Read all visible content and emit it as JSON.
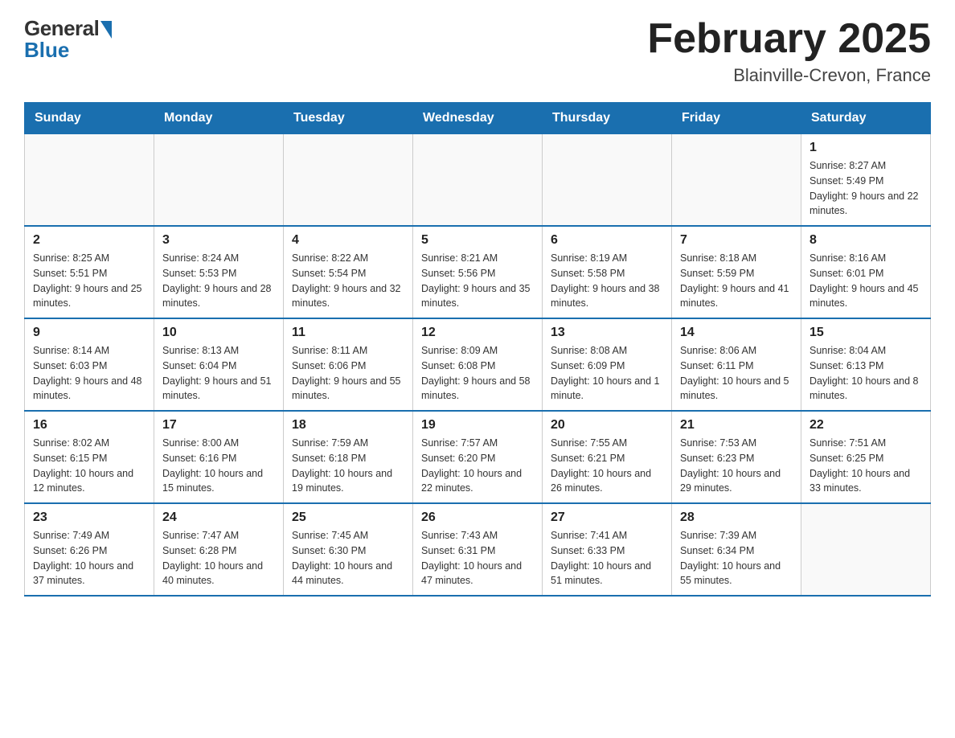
{
  "header": {
    "logo_general": "General",
    "logo_blue": "Blue",
    "title": "February 2025",
    "subtitle": "Blainville-Crevon, France"
  },
  "weekdays": [
    "Sunday",
    "Monday",
    "Tuesday",
    "Wednesday",
    "Thursday",
    "Friday",
    "Saturday"
  ],
  "weeks": [
    {
      "days": [
        {
          "number": "",
          "info": "",
          "empty": true
        },
        {
          "number": "",
          "info": "",
          "empty": true
        },
        {
          "number": "",
          "info": "",
          "empty": true
        },
        {
          "number": "",
          "info": "",
          "empty": true
        },
        {
          "number": "",
          "info": "",
          "empty": true
        },
        {
          "number": "",
          "info": "",
          "empty": true
        },
        {
          "number": "1",
          "info": "Sunrise: 8:27 AM\nSunset: 5:49 PM\nDaylight: 9 hours and 22 minutes."
        }
      ]
    },
    {
      "days": [
        {
          "number": "2",
          "info": "Sunrise: 8:25 AM\nSunset: 5:51 PM\nDaylight: 9 hours and 25 minutes."
        },
        {
          "number": "3",
          "info": "Sunrise: 8:24 AM\nSunset: 5:53 PM\nDaylight: 9 hours and 28 minutes."
        },
        {
          "number": "4",
          "info": "Sunrise: 8:22 AM\nSunset: 5:54 PM\nDaylight: 9 hours and 32 minutes."
        },
        {
          "number": "5",
          "info": "Sunrise: 8:21 AM\nSunset: 5:56 PM\nDaylight: 9 hours and 35 minutes."
        },
        {
          "number": "6",
          "info": "Sunrise: 8:19 AM\nSunset: 5:58 PM\nDaylight: 9 hours and 38 minutes."
        },
        {
          "number": "7",
          "info": "Sunrise: 8:18 AM\nSunset: 5:59 PM\nDaylight: 9 hours and 41 minutes."
        },
        {
          "number": "8",
          "info": "Sunrise: 8:16 AM\nSunset: 6:01 PM\nDaylight: 9 hours and 45 minutes."
        }
      ]
    },
    {
      "days": [
        {
          "number": "9",
          "info": "Sunrise: 8:14 AM\nSunset: 6:03 PM\nDaylight: 9 hours and 48 minutes."
        },
        {
          "number": "10",
          "info": "Sunrise: 8:13 AM\nSunset: 6:04 PM\nDaylight: 9 hours and 51 minutes."
        },
        {
          "number": "11",
          "info": "Sunrise: 8:11 AM\nSunset: 6:06 PM\nDaylight: 9 hours and 55 minutes."
        },
        {
          "number": "12",
          "info": "Sunrise: 8:09 AM\nSunset: 6:08 PM\nDaylight: 9 hours and 58 minutes."
        },
        {
          "number": "13",
          "info": "Sunrise: 8:08 AM\nSunset: 6:09 PM\nDaylight: 10 hours and 1 minute."
        },
        {
          "number": "14",
          "info": "Sunrise: 8:06 AM\nSunset: 6:11 PM\nDaylight: 10 hours and 5 minutes."
        },
        {
          "number": "15",
          "info": "Sunrise: 8:04 AM\nSunset: 6:13 PM\nDaylight: 10 hours and 8 minutes."
        }
      ]
    },
    {
      "days": [
        {
          "number": "16",
          "info": "Sunrise: 8:02 AM\nSunset: 6:15 PM\nDaylight: 10 hours and 12 minutes."
        },
        {
          "number": "17",
          "info": "Sunrise: 8:00 AM\nSunset: 6:16 PM\nDaylight: 10 hours and 15 minutes."
        },
        {
          "number": "18",
          "info": "Sunrise: 7:59 AM\nSunset: 6:18 PM\nDaylight: 10 hours and 19 minutes."
        },
        {
          "number": "19",
          "info": "Sunrise: 7:57 AM\nSunset: 6:20 PM\nDaylight: 10 hours and 22 minutes."
        },
        {
          "number": "20",
          "info": "Sunrise: 7:55 AM\nSunset: 6:21 PM\nDaylight: 10 hours and 26 minutes."
        },
        {
          "number": "21",
          "info": "Sunrise: 7:53 AM\nSunset: 6:23 PM\nDaylight: 10 hours and 29 minutes."
        },
        {
          "number": "22",
          "info": "Sunrise: 7:51 AM\nSunset: 6:25 PM\nDaylight: 10 hours and 33 minutes."
        }
      ]
    },
    {
      "days": [
        {
          "number": "23",
          "info": "Sunrise: 7:49 AM\nSunset: 6:26 PM\nDaylight: 10 hours and 37 minutes."
        },
        {
          "number": "24",
          "info": "Sunrise: 7:47 AM\nSunset: 6:28 PM\nDaylight: 10 hours and 40 minutes."
        },
        {
          "number": "25",
          "info": "Sunrise: 7:45 AM\nSunset: 6:30 PM\nDaylight: 10 hours and 44 minutes."
        },
        {
          "number": "26",
          "info": "Sunrise: 7:43 AM\nSunset: 6:31 PM\nDaylight: 10 hours and 47 minutes."
        },
        {
          "number": "27",
          "info": "Sunrise: 7:41 AM\nSunset: 6:33 PM\nDaylight: 10 hours and 51 minutes."
        },
        {
          "number": "28",
          "info": "Sunrise: 7:39 AM\nSunset: 6:34 PM\nDaylight: 10 hours and 55 minutes."
        },
        {
          "number": "",
          "info": "",
          "empty": true
        }
      ]
    }
  ]
}
